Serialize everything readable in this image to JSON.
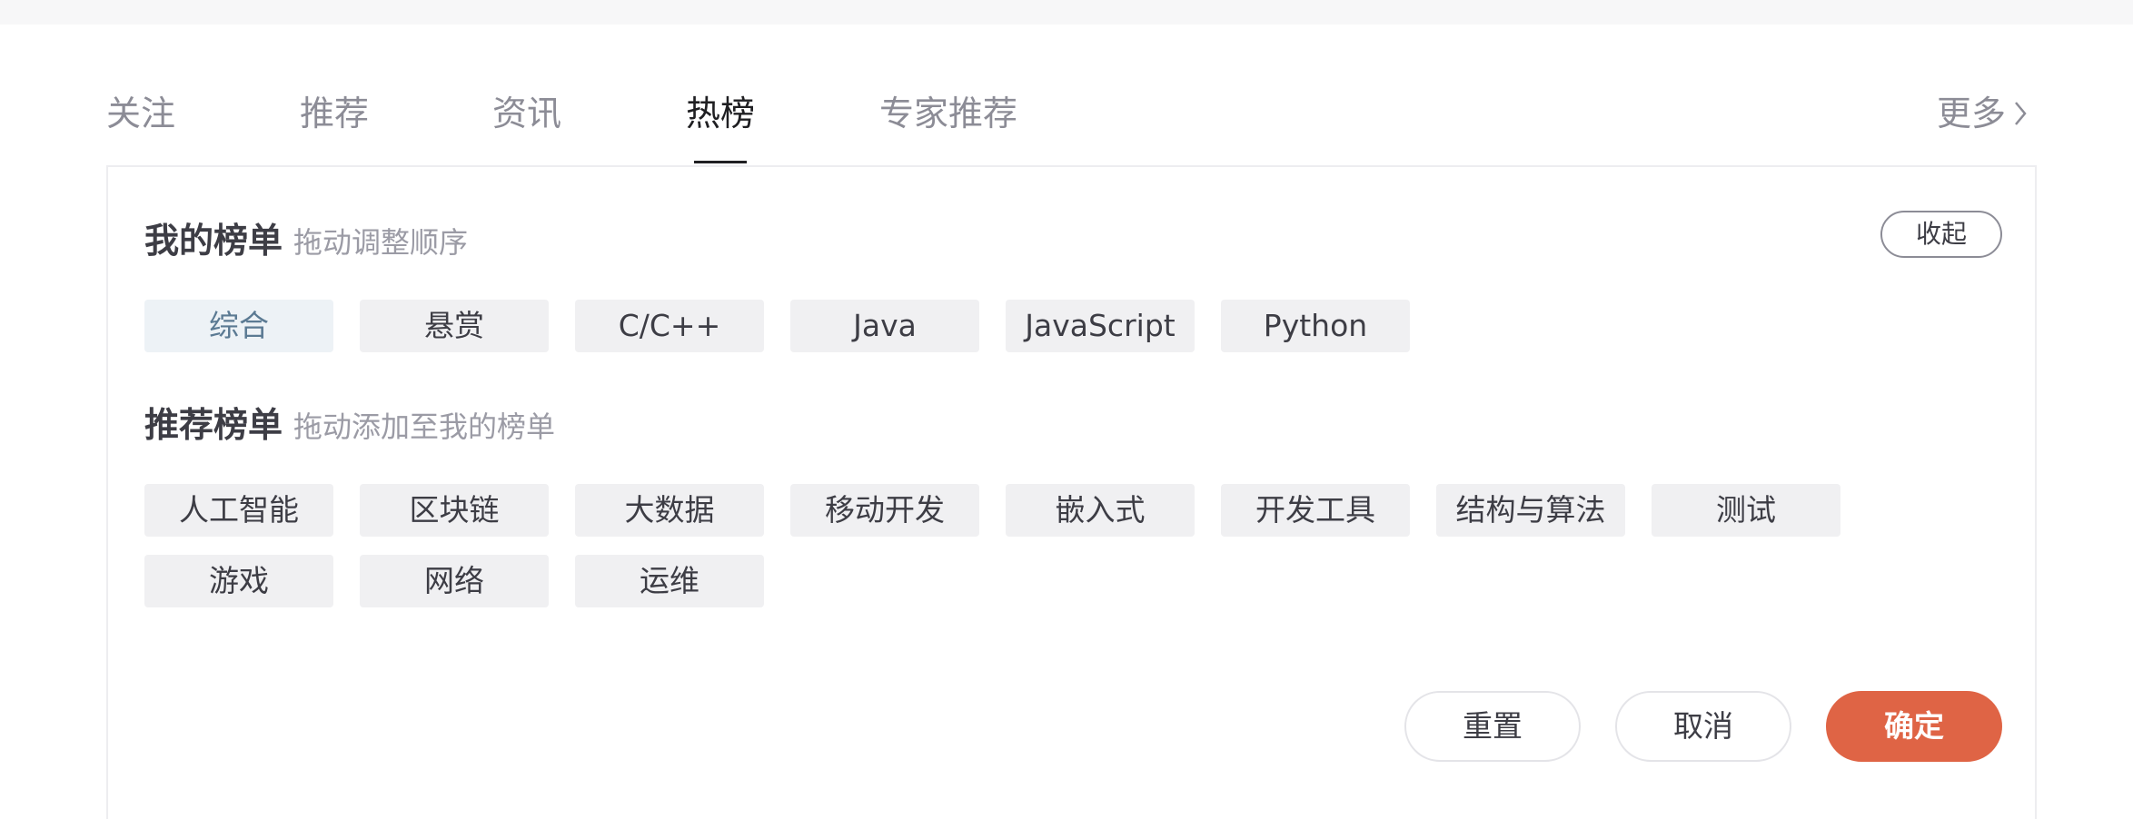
{
  "tabs": [
    {
      "label": "关注",
      "active": false
    },
    {
      "label": "推荐",
      "active": false
    },
    {
      "label": "资讯",
      "active": false
    },
    {
      "label": "热榜",
      "active": true
    },
    {
      "label": "专家推荐",
      "active": false
    }
  ],
  "more_label": "更多",
  "my_list": {
    "title": "我的榜单",
    "hint": "拖动调整顺序",
    "collapse_label": "收起",
    "tags": [
      "综合",
      "悬赏",
      "C/C++",
      "Java",
      "JavaScript",
      "Python"
    ]
  },
  "recommended_list": {
    "title": "推荐榜单",
    "hint": "拖动添加至我的榜单",
    "tags": [
      "人工智能",
      "区块链",
      "大数据",
      "移动开发",
      "嵌入式",
      "开发工具",
      "结构与算法",
      "测试",
      "游戏",
      "网络",
      "运维"
    ]
  },
  "actions": {
    "reset_label": "重置",
    "cancel_label": "取消",
    "confirm_label": "确定"
  },
  "colors": {
    "accent": "#df6445",
    "selected_tag_bg": "#edf2f6",
    "tag_bg": "#f0f0f2"
  }
}
